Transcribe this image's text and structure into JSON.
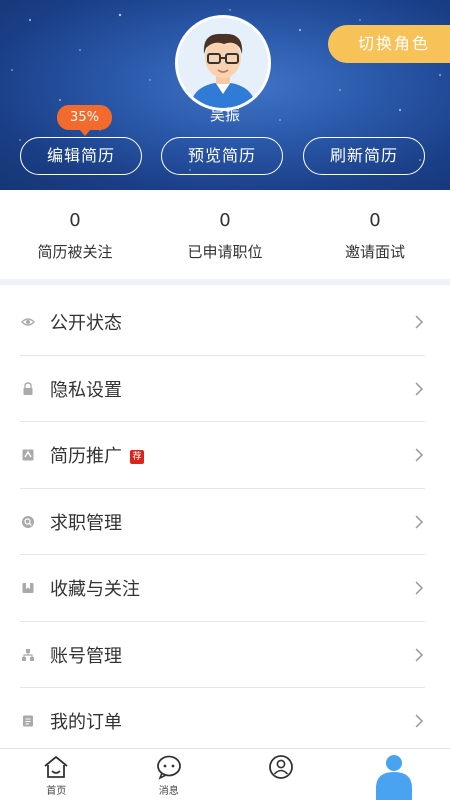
{
  "header": {
    "switch_role": "切换角色",
    "username": "吴振",
    "resume_progress": "35%",
    "buttons": {
      "edit": "编辑简历",
      "preview": "预览简历",
      "refresh": "刷新简历"
    }
  },
  "stats": [
    {
      "value": "0",
      "label": "简历被关注"
    },
    {
      "value": "0",
      "label": "已申请职位"
    },
    {
      "value": "0",
      "label": "邀请面试"
    }
  ],
  "menu": [
    {
      "label": "公开状态",
      "icon": "eye-icon"
    },
    {
      "label": "隐私设置",
      "icon": "lock-icon"
    },
    {
      "label": "简历推广",
      "icon": "promote-icon",
      "tag": "荐"
    },
    {
      "label": "求职管理",
      "icon": "job-search-icon"
    },
    {
      "label": "收藏与关注",
      "icon": "bookmark-icon"
    },
    {
      "label": "账号管理",
      "icon": "account-tree-icon"
    },
    {
      "label": "我的订单",
      "icon": "order-icon"
    }
  ],
  "bottom_nav": [
    {
      "label": "首页",
      "icon": "home-icon"
    },
    {
      "label": "消息",
      "icon": "message-icon"
    },
    {
      "label": "",
      "icon": "user-circle-icon"
    },
    {
      "label": "",
      "icon": "profile-icon",
      "active": true
    }
  ],
  "colors": {
    "header_blue": "#2957a8",
    "switch_role_bg": "#f7c359",
    "progress_badge_bg": "#f26b2c",
    "tag_red": "#d9261c",
    "active_nav": "#4aa3f0"
  }
}
